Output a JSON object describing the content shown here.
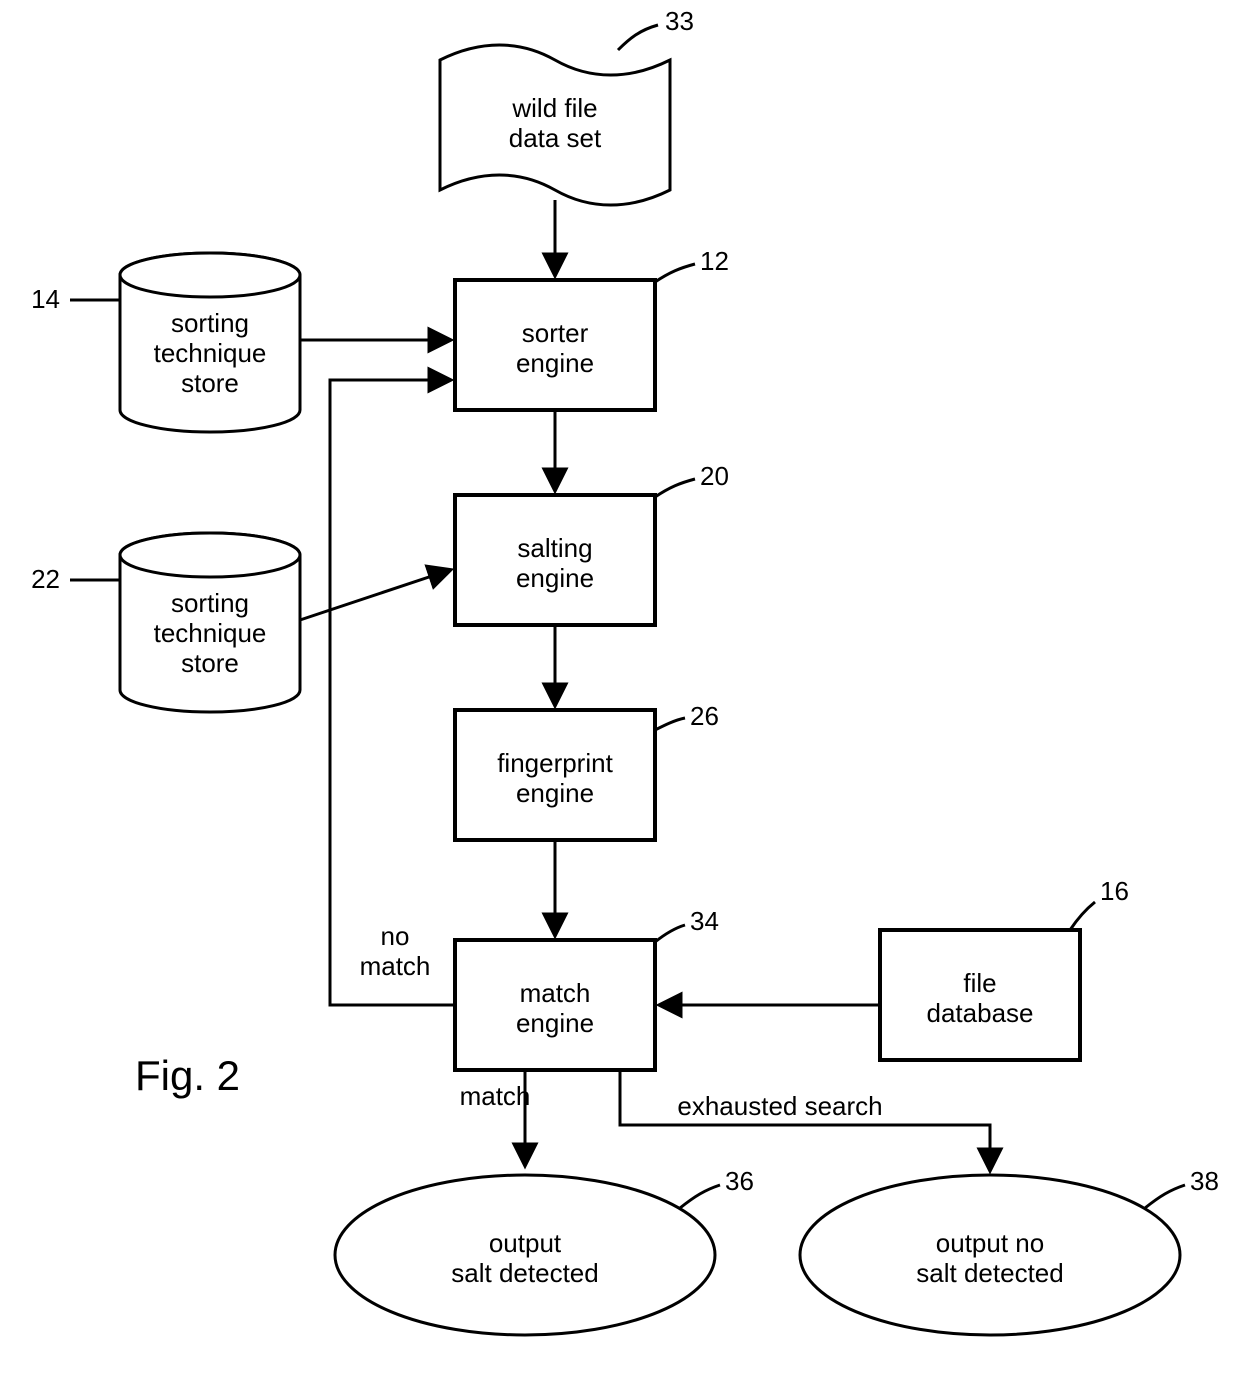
{
  "figure_label": "Fig. 2",
  "nodes": {
    "wild_file": {
      "line1": "wild file",
      "line2": "data set",
      "ref": "33"
    },
    "sorter_engine": {
      "line1": "sorter",
      "line2": "engine",
      "ref": "12"
    },
    "sorting_store_1": {
      "line1": "sorting",
      "line2": "technique",
      "line3": "store",
      "ref": "14"
    },
    "salting_engine": {
      "line1": "salting",
      "line2": "engine",
      "ref": "20"
    },
    "sorting_store_2": {
      "line1": "sorting",
      "line2": "technique",
      "line3": "store",
      "ref": "22"
    },
    "fingerprint_engine": {
      "line1": "fingerprint",
      "line2": "engine",
      "ref": "26"
    },
    "match_engine": {
      "line1": "match",
      "line2": "engine",
      "ref": "34"
    },
    "file_database": {
      "line1": "file",
      "line2": "database",
      "ref": "16"
    },
    "output_salt": {
      "line1": "output",
      "line2": "salt detected",
      "ref": "36"
    },
    "output_no_salt": {
      "line1": "output no",
      "line2": "salt detected",
      "ref": "38"
    }
  },
  "edges": {
    "no_match": {
      "line1": "no",
      "line2": "match"
    },
    "match": "match",
    "exhausted": "exhausted search"
  }
}
